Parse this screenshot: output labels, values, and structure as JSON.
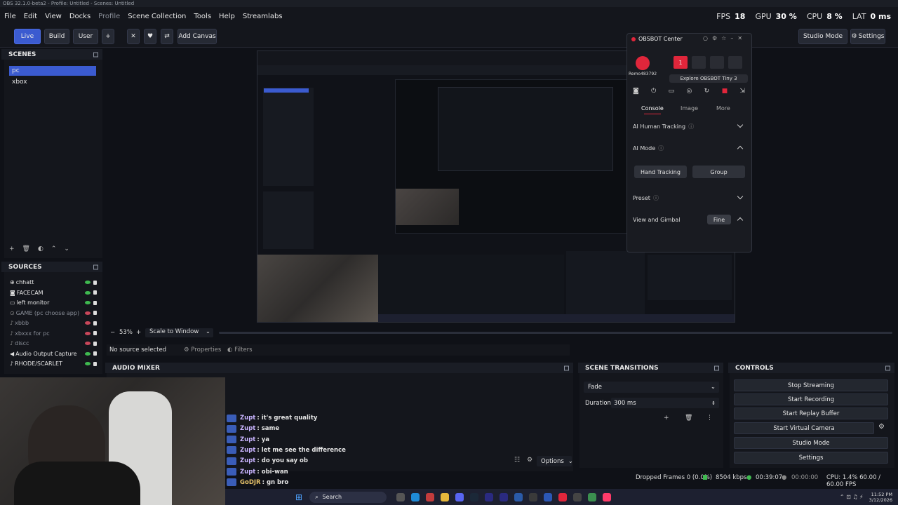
{
  "window_title": "OBS 32.1.0-beta2 - Profile: Untitled - Scenes: Untitled",
  "menu": [
    "File",
    "Edit",
    "View",
    "Docks",
    "Profile",
    "Scene Collection",
    "Tools",
    "Help",
    "Streamlabs"
  ],
  "stats": {
    "fps_label": "FPS",
    "fps": "18",
    "gpu_label": "GPU",
    "gpu": "30 %",
    "cpu_label": "CPU",
    "cpu": "8 %",
    "lat_label": "LAT",
    "lat": "0 ms"
  },
  "toolbar": {
    "live": "Live",
    "build": "Build",
    "user": "User",
    "add_canvas": "Add Canvas",
    "studio_mode": "Studio Mode",
    "settings": "Settings"
  },
  "scenes": {
    "title": "SCENES",
    "items": [
      "pc",
      "xbox"
    ]
  },
  "sources": {
    "title": "SOURCES",
    "items": [
      {
        "name": "chhatt",
        "visible": true
      },
      {
        "name": "FACECAM",
        "visible": true
      },
      {
        "name": "left monitor",
        "visible": true
      },
      {
        "name": "GAME (pc choose app)",
        "visible": false
      },
      {
        "name": "xbbb",
        "visible": false
      },
      {
        "name": "xbxxx for pc",
        "visible": false
      },
      {
        "name": "discc",
        "visible": false
      },
      {
        "name": "Audio Output Capture",
        "visible": true
      },
      {
        "name": "RHODE/SCARLET",
        "visible": true
      }
    ]
  },
  "preview_bar": {
    "zoom": "53%",
    "scale_mode": "Scale to Window",
    "no_source": "No source selected",
    "properties": "Properties",
    "filters": "Filters"
  },
  "obsbot": {
    "title": "OBSBOT Center",
    "device": "Remo483792",
    "explore": "Explore OBSBOT Tiny 3",
    "tabs": [
      "Console",
      "Image",
      "More"
    ],
    "ai_human_tracking": "AI Human Tracking",
    "ai_mode": "AI Mode",
    "hand_tracking": "Hand Tracking",
    "group": "Group",
    "preset": "Preset",
    "view_gimbal": "View and Gimbal",
    "fine": "Fine",
    "slot_number": "1"
  },
  "audio_mixer": {
    "title": "AUDIO MIXER",
    "options": "Options"
  },
  "chat": [
    {
      "user": "Zupt",
      "msg": ": it's great quality"
    },
    {
      "user": "Zupt",
      "msg": ": same"
    },
    {
      "user": "Zupt",
      "msg": ": ya"
    },
    {
      "user": "Zupt",
      "msg": ": let me see the difference"
    },
    {
      "user": "Zupt",
      "msg": ": do you say ob"
    },
    {
      "user": "Zupt",
      "msg": ": obi-wan"
    },
    {
      "user": "GoDJR",
      "msg": ": gn bro"
    },
    {
      "user": "GoDJR",
      "msg": ":"
    }
  ],
  "scene_transitions": {
    "title": "SCENE TRANSITIONS",
    "transition": "Fade",
    "duration_label": "Duration",
    "duration": "300 ms"
  },
  "controls": {
    "title": "CONTROLS",
    "buttons": [
      "Stop Streaming",
      "Start Recording",
      "Start Replay Buffer",
      "Start Virtual Camera",
      "Studio Mode",
      "Settings"
    ]
  },
  "status": {
    "dropped": "Dropped Frames 0 (0.0%)",
    "bitrate": "8504 kbps",
    "stream_time": "00:39:07",
    "rec_time": "00:00:00",
    "cpu_fps": "CPU: 1.4%  60.00 / 60.00 FPS"
  },
  "taskbar": {
    "search": "Search",
    "time": "11:52 PM",
    "date": "3/12/2026"
  },
  "colors": {
    "accent": "#3b5bd0",
    "bg": "#0f1117",
    "panel": "#14161c",
    "obsbot_red": "#e0263b",
    "eye_on": "#3fb950",
    "eye_off": "#c9475a"
  }
}
